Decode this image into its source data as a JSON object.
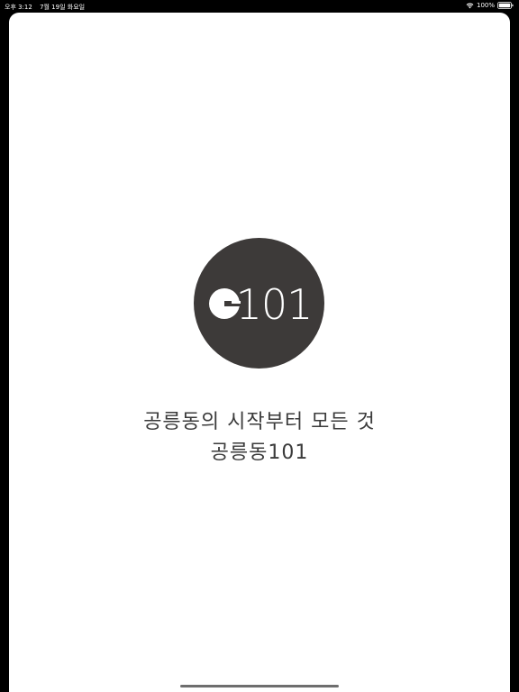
{
  "status_bar": {
    "time": "오후 3:12",
    "date": "7월 19일 화요일",
    "battery": "100%"
  },
  "splash": {
    "logo_text": "101",
    "tagline_line1": "공릉동의 시작부터 모든 것",
    "tagline_line2": "공릉동101"
  },
  "colors": {
    "logo_circle": "#3d3a39",
    "text": "#3b3b3b",
    "background": "#ffffff"
  }
}
